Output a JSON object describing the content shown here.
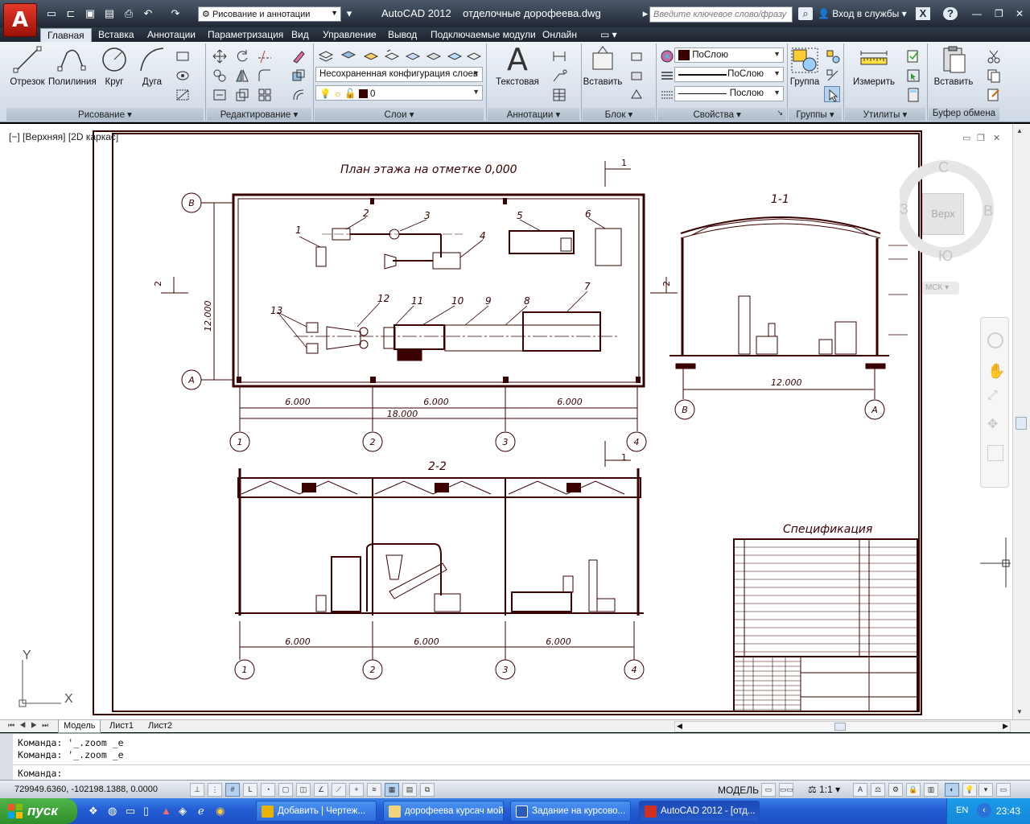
{
  "titlebar": {
    "logo": "A",
    "workspace": "Рисование и аннотации",
    "title": "AutoCAD 2012    отделочные дорофеева.dwg",
    "search_placeholder": "Введите ключевое слово/фразу",
    "signin": "Вход в службы"
  },
  "tabs": [
    "Главная",
    "Вставка",
    "Аннотации",
    "Параметризация",
    "Вид",
    "Управление",
    "Вывод",
    "Подключаемые модули",
    "Онлайн"
  ],
  "ribbon": {
    "draw": {
      "title": "Рисование",
      "line": "Отрезок",
      "polyline": "Полилиния",
      "circle": "Круг",
      "arc": "Дуга"
    },
    "modify": {
      "title": "Редактирование"
    },
    "layers": {
      "title": "Слои",
      "layer_state": "Несохраненная конфигурация слоев",
      "current_layer": "0"
    },
    "annotation": {
      "title": "Аннотации",
      "text": "Текстовая"
    },
    "block": {
      "title": "Блок",
      "insert": "Вставить"
    },
    "properties": {
      "title": "Свойства",
      "color": "ПоСлою",
      "linetype": "ПоСлою",
      "lineweight": "Послою"
    },
    "groups": {
      "title": "Группы",
      "group": "Группа"
    },
    "utilities": {
      "title": "Утилиты",
      "measure": "Измерить"
    },
    "clipboard": {
      "title": "Буфер обмена",
      "paste": "Вставить"
    }
  },
  "viewport": {
    "label": "[−] [Верхняя] [2D каркас]"
  },
  "viewcube": {
    "n": "С",
    "s": "Ю",
    "w": "З",
    "e": "В",
    "face": "Верх",
    "ucs": "МСК"
  },
  "drawing": {
    "plan_title": "План этажа на отметке 0,000",
    "section_11": "1-1",
    "section_22": "2-2",
    "spec_title": "Спецификация",
    "dim_6000": "6.000",
    "dim_18000": "18.000",
    "dim_12000": "12.000",
    "axis_letters": [
      "В",
      "А"
    ],
    "axis_numbers": [
      "1",
      "2",
      "3",
      "4"
    ],
    "callouts": [
      "1",
      "2",
      "3",
      "4",
      "5",
      "6",
      "7",
      "8",
      "9",
      "10",
      "11",
      "12",
      "13"
    ],
    "section_mark_1": "1",
    "section_mark_2": "2"
  },
  "ucs": {
    "x": "X",
    "y": "Y"
  },
  "layout_tabs": [
    "Модель",
    "Лист1",
    "Лист2"
  ],
  "command": {
    "line1": "Команда:  '_.zoom _e",
    "line2": "Команда:  '_.zoom _e",
    "prompt": "Команда:"
  },
  "status": {
    "coords": "729949.6360, -102198.1388, 0.0000",
    "model": "МОДЕЛЬ",
    "scale": "1:1"
  },
  "taskbar": {
    "start": "пуск",
    "tasks": [
      "Добавить | Чертеж...",
      "дорофеева курсач мой",
      "Задание на курсово...",
      "AutoCAD 2012 - [отд..."
    ],
    "lang": "EN",
    "clock": "23:43"
  }
}
